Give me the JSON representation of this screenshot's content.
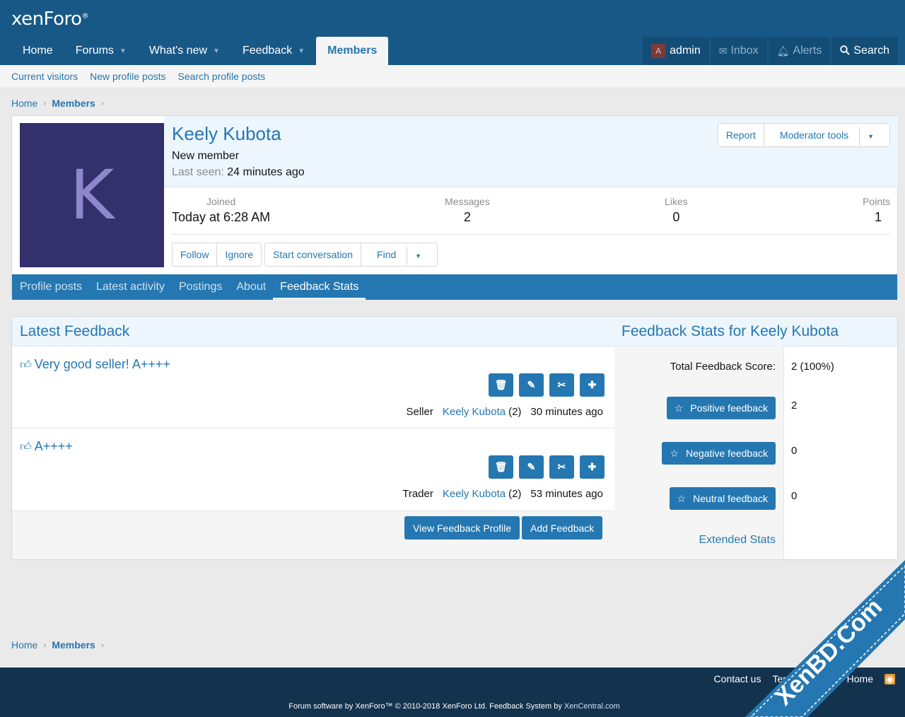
{
  "header": {
    "logo_text": "xenForo",
    "logo_mark": "®",
    "nav": [
      {
        "label": "Home",
        "dropdown": false
      },
      {
        "label": "Forums",
        "dropdown": true
      },
      {
        "label": "What's new",
        "dropdown": true
      },
      {
        "label": "Feedback",
        "dropdown": true
      },
      {
        "label": "Members",
        "dropdown": false,
        "active": true
      }
    ],
    "user_initial": "A",
    "user_name": "admin",
    "inbox_label": "Inbox",
    "alerts_label": "Alerts",
    "search_label": "Search"
  },
  "subnav": [
    "Current visitors",
    "New profile posts",
    "Search profile posts"
  ],
  "breadcrumb": {
    "home": "Home",
    "members": "Members"
  },
  "profile": {
    "avatar_letter": "K",
    "name": "Keely Kubota",
    "title": "New member",
    "last_seen_label": "Last seen:",
    "last_seen_value": "24 minutes ago",
    "report_label": "Report",
    "moderator_label": "Moderator tools",
    "stats": [
      {
        "label": "Joined",
        "value": "Today at 6:28 AM"
      },
      {
        "label": "Messages",
        "value": "2"
      },
      {
        "label": "Likes",
        "value": "0"
      },
      {
        "label": "Points",
        "value": "1"
      }
    ],
    "actions": {
      "follow": "Follow",
      "ignore": "Ignore",
      "start": "Start conversation",
      "find": "Find"
    },
    "tabs": [
      "Profile posts",
      "Latest activity",
      "Postings",
      "About",
      "Feedback Stats"
    ]
  },
  "feedback": {
    "latest_heading": "Latest Feedback",
    "stats_heading": "Feedback Stats for Keely Kubota",
    "items": [
      {
        "title": "Very good seller! A++++",
        "role": "Seller",
        "user": "Keely Kubota",
        "count": "(2)",
        "time": "30 minutes ago"
      },
      {
        "title": "A++++",
        "role": "Trader",
        "user": "Keely Kubota",
        "count": "(2)",
        "time": "53 minutes ago"
      }
    ],
    "view_profile": "View Feedback Profile",
    "add_feedback": "Add Feedback",
    "total_label": "Total Feedback Score:",
    "total_value": "2 (100%)",
    "positive_label": "Positive feedback",
    "positive_value": "2",
    "negative_label": "Negative feedback",
    "negative_value": "0",
    "neutral_label": "Neutral feedback",
    "neutral_value": "0",
    "extended": "Extended Stats"
  },
  "footer": {
    "links": [
      "Contact us",
      "Terms and",
      "p",
      "Home"
    ],
    "copyright_pre": "Forum software by XenForo™ © 2010-2018 XenForo Ltd. Feedback System by ",
    "copyright_link": "XenCentral.com"
  },
  "watermark": "XenBD.Com",
  "colors": {
    "accent": "#2577b1",
    "header": "#185886",
    "footer": "#12324e",
    "rss": "#e59a30"
  }
}
